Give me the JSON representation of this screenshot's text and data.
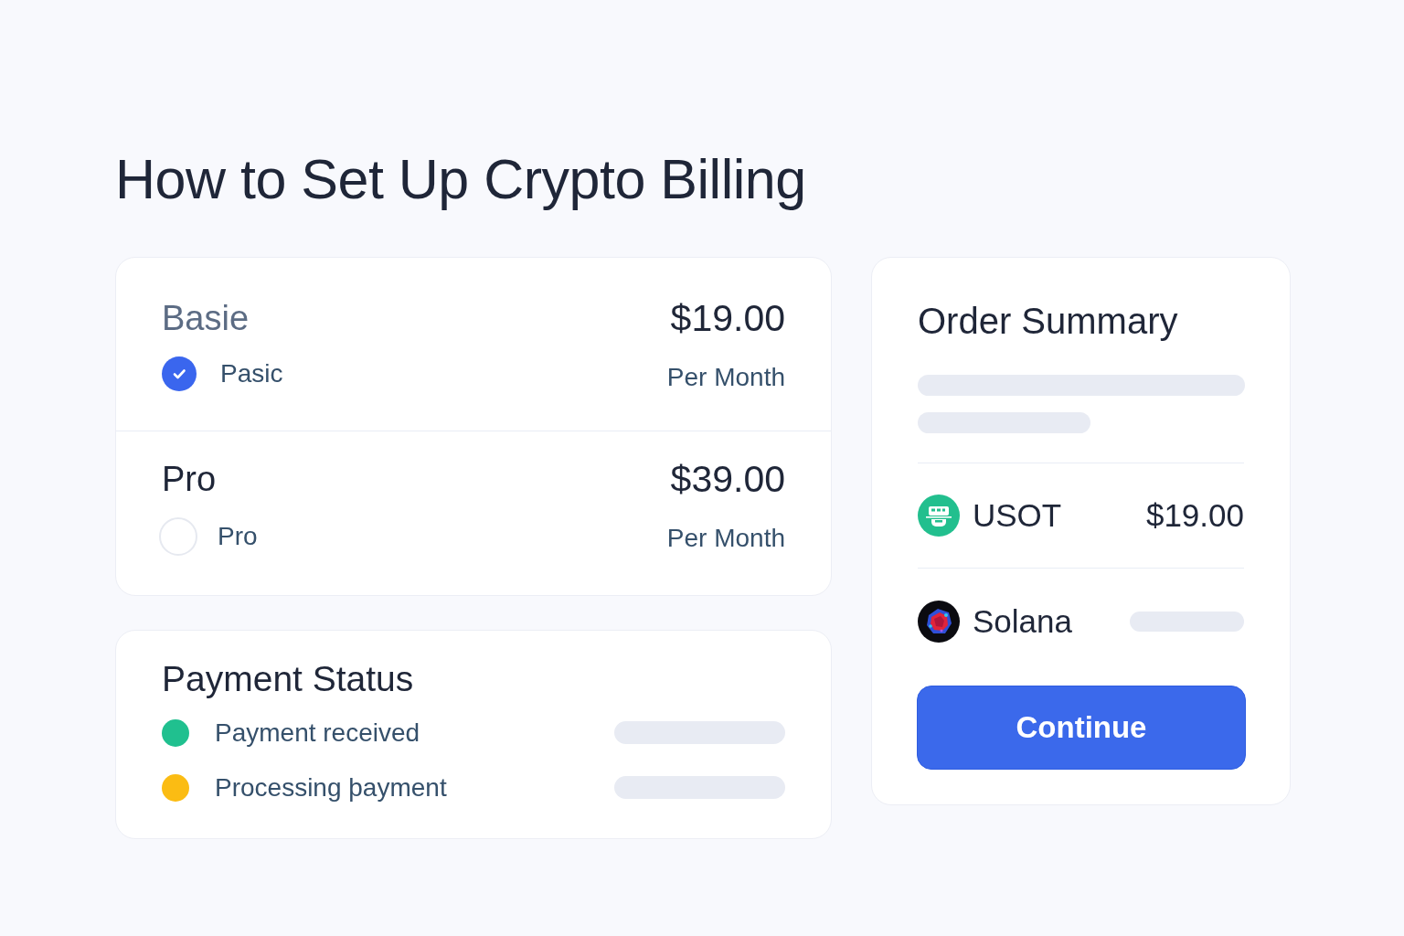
{
  "title": "How to Set Up Crypto Billing",
  "plans": [
    {
      "name": "Basie",
      "price": "$19.00",
      "option_label": "Pasic",
      "period": "Per Month",
      "selected": true
    },
    {
      "name": "Pro",
      "price": "$39.00",
      "option_label": "Pro",
      "period": "Per Month",
      "selected": false
    }
  ],
  "payment_status": {
    "title": "Payment Status",
    "items": [
      {
        "label": "Payment received",
        "color": "#20c08f"
      },
      {
        "label": "Processing þayment",
        "color": "#fbbc13"
      }
    ]
  },
  "order_summary": {
    "title": "Order Summary",
    "currencies": [
      {
        "kind": "glyph",
        "name": "USOT",
        "amount": "$19.00"
      },
      {
        "kind": "swirl",
        "name": "Solana"
      }
    ],
    "button": "Continue"
  }
}
